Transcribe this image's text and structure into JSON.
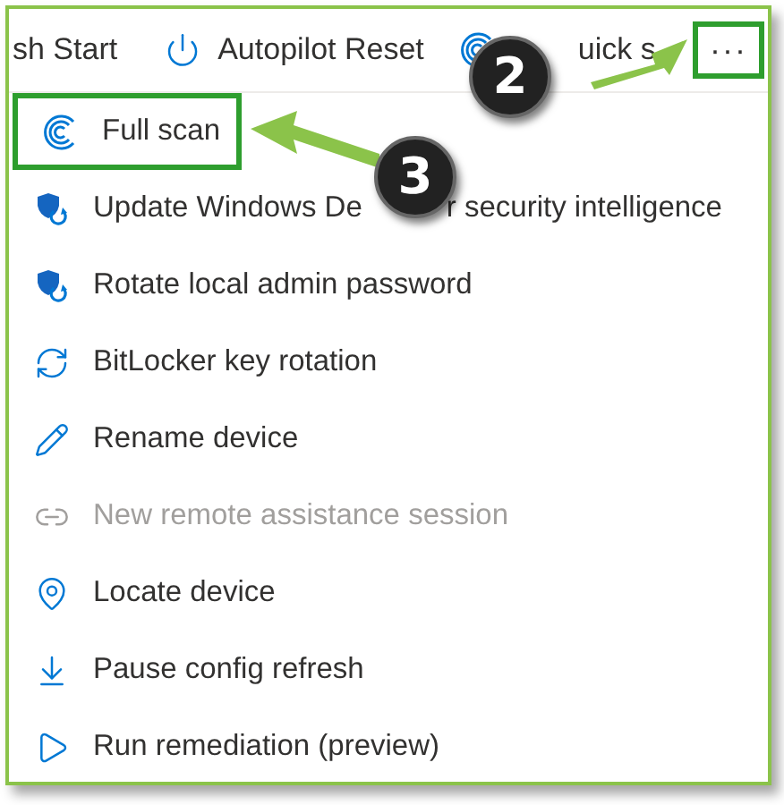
{
  "toolbar": [
    {
      "label": "sh Start",
      "kind": "plain"
    },
    {
      "label": "Autopilot Reset",
      "kind": "power"
    },
    {
      "label": "uick s",
      "kind": "scan"
    }
  ],
  "more_button": {
    "label": "···",
    "highlighted": true
  },
  "menu": [
    {
      "label": "Full scan",
      "kind": "scan",
      "disabled": false,
      "highlighted": true
    },
    {
      "label": "Update Windows De",
      "label_continued": "r security intelligence",
      "kind": "shield",
      "disabled": false,
      "highlighted": false
    },
    {
      "label": "Rotate local admin password",
      "kind": "shield",
      "disabled": false,
      "highlighted": false
    },
    {
      "label": "BitLocker key rotation",
      "kind": "rotate",
      "disabled": false,
      "highlighted": false
    },
    {
      "label": "Rename device",
      "kind": "pencil",
      "disabled": false,
      "highlighted": false
    },
    {
      "label": "New remote assistance session",
      "kind": "link",
      "disabled": true,
      "highlighted": false
    },
    {
      "label": "Locate device",
      "kind": "pin",
      "disabled": false,
      "highlighted": false
    },
    {
      "label": "Pause config refresh",
      "kind": "download",
      "disabled": false,
      "highlighted": false
    },
    {
      "label": "Run remediation (preview)",
      "kind": "play",
      "disabled": false,
      "highlighted": false
    }
  ],
  "callouts": [
    {
      "label": "2"
    },
    {
      "label": "3"
    }
  ]
}
